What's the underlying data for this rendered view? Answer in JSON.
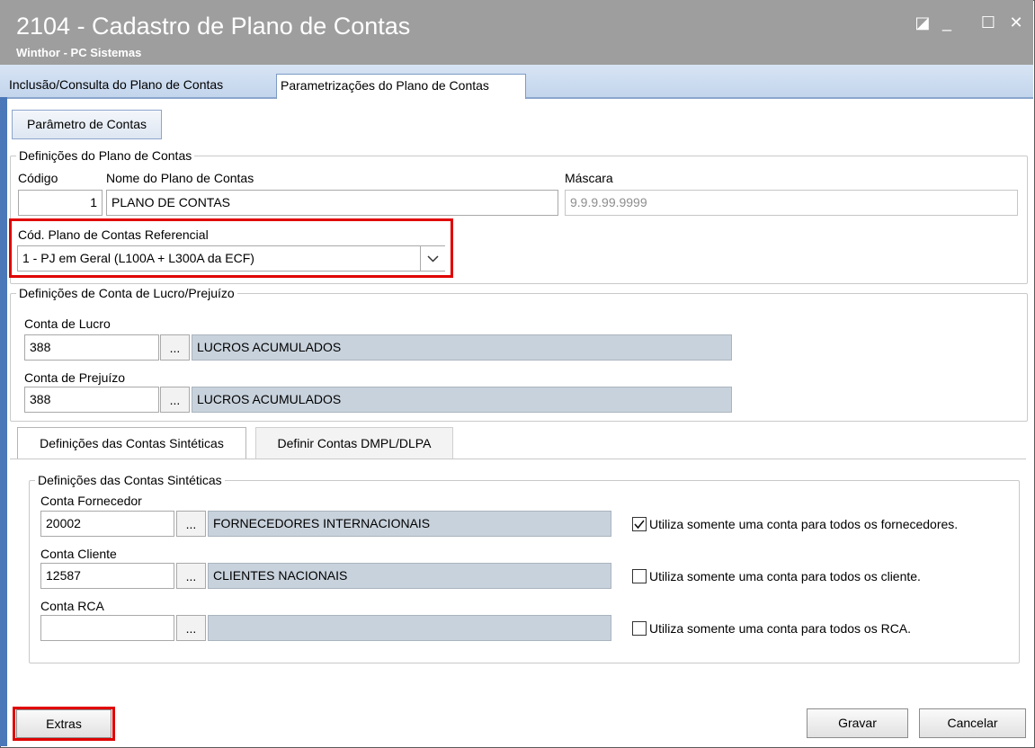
{
  "window": {
    "title": "2104 - Cadastro de Plano de Contas",
    "subtitle": "Winthor - PC Sistemas",
    "controls": {
      "restore": "◪",
      "minimize": "_",
      "maximize": "☐",
      "close": "✕"
    }
  },
  "tabs": [
    {
      "label": "Inclusão/Consulta do Plano de Contas",
      "selected": false
    },
    {
      "label": "Parametrizações do Plano de Contas",
      "selected": true
    }
  ],
  "parametro_button": "Parâmetro de Contas",
  "definicoes_plano": {
    "legend": "Definições do Plano de Contas",
    "codigo_label": "Código",
    "codigo_value": "1",
    "nome_label": "Nome do Plano de Contas",
    "nome_value": "PLANO DE CONTAS",
    "mascara_label": "Máscara",
    "mascara_value": "9.9.9.99.9999",
    "referencial_label": "Cód. Plano de Contas Referencial",
    "referencial_value": "1 - PJ em Geral (L100A + L300A da ECF)"
  },
  "lucro_prejuizo": {
    "legend": "Definições de Conta de Lucro/Prejuízo",
    "lucro_label": "Conta de Lucro",
    "lucro_code": "388",
    "lucro_desc": "LUCROS ACUMULADOS",
    "prejuizo_label": "Conta de Prejuízo",
    "prejuizo_code": "388",
    "prejuizo_desc": "LUCROS ACUMULADOS",
    "lookup": "..."
  },
  "inner_tabs": [
    {
      "label": "Definições das Contas Sintéticas",
      "selected": true
    },
    {
      "label": "Definir Contas DMPL/DLPA",
      "selected": false
    }
  ],
  "sinteticas": {
    "legend": "Definições das Contas Sintéticas",
    "lookup": "...",
    "fornecedor_label": "Conta Fornecedor",
    "fornecedor_code": "20002",
    "fornecedor_desc": "FORNECEDORES INTERNACIONAIS",
    "fornecedor_check_label": "Utiliza somente uma conta para todos os fornecedores.",
    "fornecedor_checked": true,
    "cliente_label": "Conta Cliente",
    "cliente_code": "12587",
    "cliente_desc": "CLIENTES NACIONAIS",
    "cliente_check_label": "Utiliza somente uma conta para todos os cliente.",
    "cliente_checked": false,
    "rca_label": "Conta RCA",
    "rca_code": "",
    "rca_desc": "",
    "rca_check_label": "Utiliza somente uma conta para todos os RCA.",
    "rca_checked": false
  },
  "buttons": {
    "extras": "Extras",
    "gravar": "Gravar",
    "cancelar": "Cancelar"
  },
  "colors": {
    "highlight": "#e00000",
    "titlebar": "#9e9e9e",
    "readonly_field": "#c8d2dc"
  }
}
